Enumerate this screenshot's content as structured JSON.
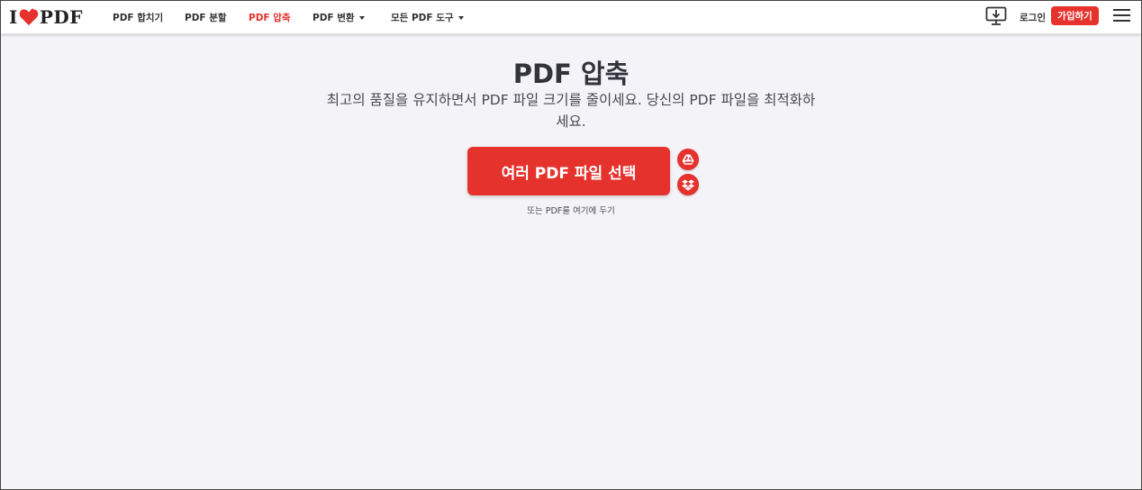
{
  "header": {
    "logo": {
      "left": "I",
      "right": "PDF"
    },
    "nav": [
      {
        "label": "PDF 합치기",
        "active": false,
        "dropdown": false
      },
      {
        "label": "PDF 분할",
        "active": false,
        "dropdown": false
      },
      {
        "label": "PDF 압축",
        "active": true,
        "dropdown": false
      },
      {
        "label": "PDF 변환",
        "active": false,
        "dropdown": true
      },
      {
        "label": "모든 PDF 도구",
        "active": false,
        "dropdown": true
      }
    ],
    "desktop_icon": "desktop-download-icon",
    "login_label": "로그인",
    "signup_label": "가입하기",
    "menu_icon": "hamburger-menu-icon"
  },
  "main": {
    "title": "PDF 압축",
    "subtitle": "최고의 품질을 유지하면서 PDF 파일 크기를 줄이세요. 당신의 PDF 파일을 최적화하세요.",
    "select_button_label": "여러 PDF 파일 선택",
    "cloud_buttons": [
      {
        "icon": "google-drive-icon"
      },
      {
        "icon": "dropbox-icon"
      }
    ],
    "drop_text": "또는 PDF를 여기에 두기"
  },
  "colors": {
    "accent": "#e5322d",
    "background": "#f4f4f8",
    "text_dark": "#33333b"
  }
}
